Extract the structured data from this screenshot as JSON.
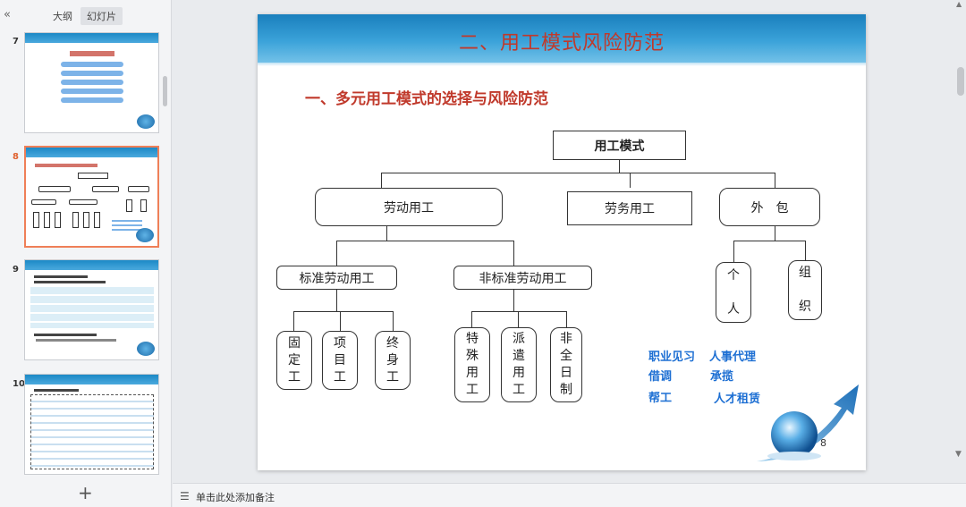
{
  "left_panel": {
    "collapse_icon": "«",
    "tabs": [
      "大纲",
      "幻灯片"
    ],
    "slide_numbers": [
      "7",
      "8",
      "9",
      "10"
    ],
    "add_slide_icon": "+"
  },
  "slide": {
    "title": "二、用工模式风险防范",
    "section_title": "一、多元用工模式的选择与风险防范",
    "root": "用工模式",
    "level1": [
      "劳动用工",
      "劳务用工",
      "外　包"
    ],
    "labor": [
      "标准劳动用工",
      "非标准劳动用工"
    ],
    "standard": [
      "固\n定\n工",
      "项\n目\n工",
      "终\n身\n工"
    ],
    "nonstandard": [
      "特\n殊\n用\n工",
      "派\n遣\n用\n工",
      "非\n全\n日\n制"
    ],
    "outsourcing": [
      "个\n\n人",
      "组\n\n织"
    ],
    "other_forms": [
      "职业见习",
      "人事代理",
      "借调",
      "承揽",
      "帮工",
      "人才租赁"
    ],
    "slide_number": "8"
  },
  "notes": {
    "placeholder": "单击此处添加备注"
  },
  "colors": {
    "title_red": "#c0392b",
    "header_blue": "#1a7fbd",
    "text_blue": "#1d6fd3",
    "selection_orange": "#ef7f58"
  }
}
